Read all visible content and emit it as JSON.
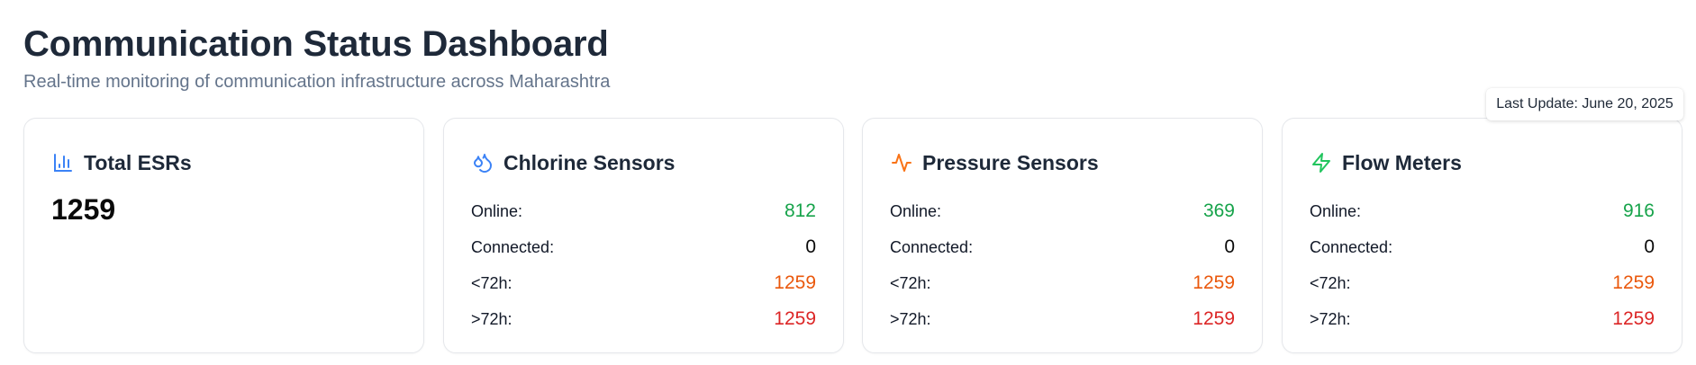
{
  "header": {
    "title": "Communication Status Dashboard",
    "subtitle": "Real-time monitoring of communication infrastructure across Maharashtra"
  },
  "last_update": "Last Update: June 20, 2025",
  "colors": {
    "online": "#16a34a",
    "connected": "#0a0a0a",
    "under72": "#ea580c",
    "over72": "#dc2626",
    "esr_icon": "#3b82f6",
    "chlorine_icon": "#3b82f6",
    "pressure_icon": "#f97316",
    "flow_icon": "#22c55e"
  },
  "total_esrs": {
    "icon": "bar-chart-icon",
    "title": "Total ESRs",
    "value": "1259"
  },
  "cards": [
    {
      "icon": "droplets-icon",
      "title": "Chlorine Sensors",
      "stats": [
        {
          "label": "Online:",
          "value": "812"
        },
        {
          "label": "Connected:",
          "value": "0"
        },
        {
          "label": "<72h:",
          "value": "1259"
        },
        {
          "label": ">72h:",
          "value": "1259"
        }
      ]
    },
    {
      "icon": "activity-icon",
      "title": "Pressure Sensors",
      "stats": [
        {
          "label": "Online:",
          "value": "369"
        },
        {
          "label": "Connected:",
          "value": "0"
        },
        {
          "label": "<72h:",
          "value": "1259"
        },
        {
          "label": ">72h:",
          "value": "1259"
        }
      ]
    },
    {
      "icon": "zap-icon",
      "title": "Flow Meters",
      "stats": [
        {
          "label": "Online:",
          "value": "916"
        },
        {
          "label": "Connected:",
          "value": "0"
        },
        {
          "label": "<72h:",
          "value": "1259"
        },
        {
          "label": ">72h:",
          "value": "1259"
        }
      ]
    }
  ]
}
